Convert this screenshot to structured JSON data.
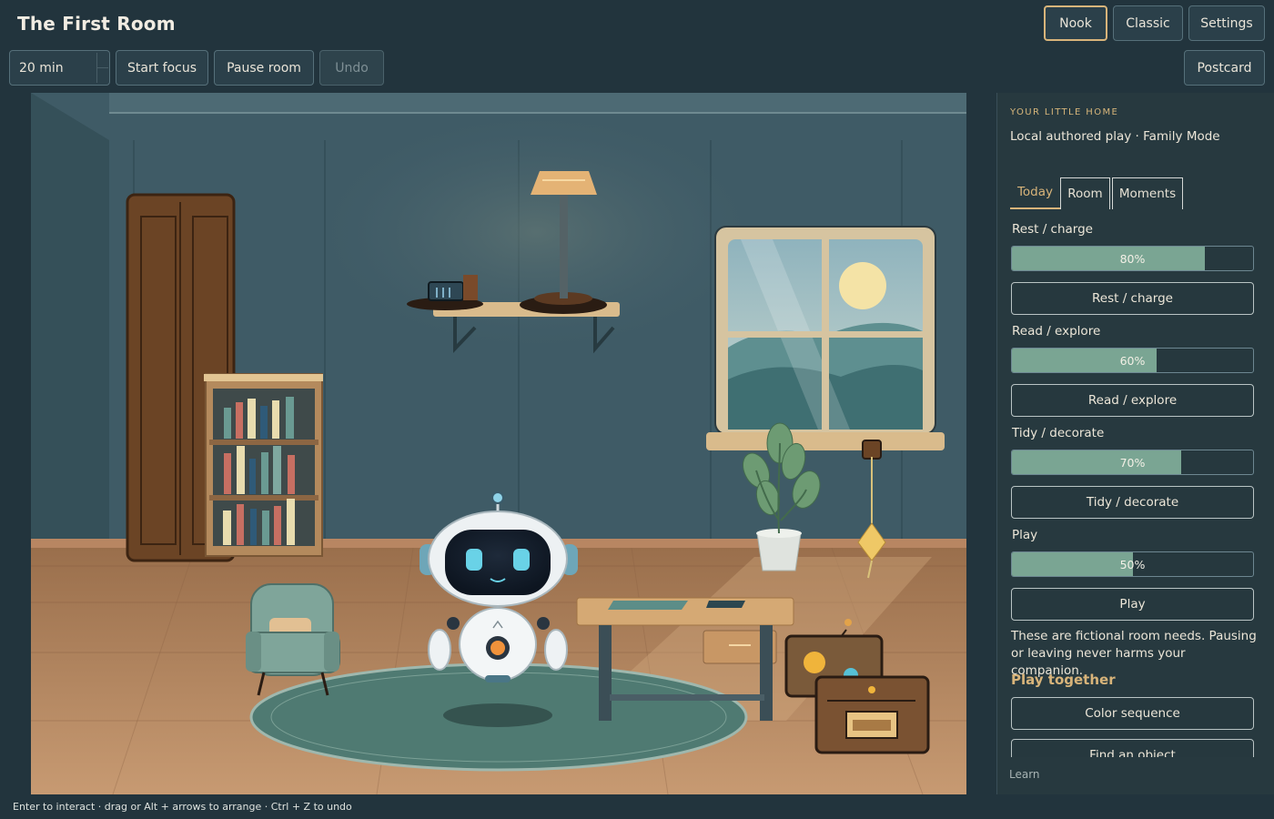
{
  "app": {
    "title": "The First Room"
  },
  "modes": {
    "nook": "Nook",
    "classic": "Classic",
    "active": "Nook"
  },
  "toolbar": {
    "settings": "Settings",
    "duration": "20 min",
    "start_focus": "Start focus",
    "pause_room": "Pause room",
    "undo": "Undo",
    "postcard": "Postcard"
  },
  "panel": {
    "eyebrow": "YOUR LITTLE HOME",
    "subtitle": "Local authored play · Family Mode",
    "tabs": [
      "Today",
      "Room",
      "Moments"
    ],
    "active_tab": "Today",
    "needs": [
      {
        "label": "Rest / charge",
        "value": 80,
        "display": "80%",
        "action": "Rest / charge"
      },
      {
        "label": "Read / explore",
        "value": 60,
        "display": "60%",
        "action": "Read / explore"
      },
      {
        "label": "Tidy / decorate",
        "value": 70,
        "display": "70%",
        "action": "Tidy / decorate"
      },
      {
        "label": "Play",
        "value": 50,
        "display": "50%",
        "action": "Play"
      }
    ],
    "note": "These are fictional room needs. Pausing or leaving never harms your companion.",
    "play_heading": "Play together",
    "games": [
      "Color sequence",
      "Find an object"
    ],
    "learn": "Learn"
  },
  "hint": "Enter to interact · drag or Alt + arrows to arrange · Ctrl + Z to undo",
  "colors": {
    "accent": "#d8b47a",
    "fill": "#7aa593",
    "background": "#22343d"
  }
}
